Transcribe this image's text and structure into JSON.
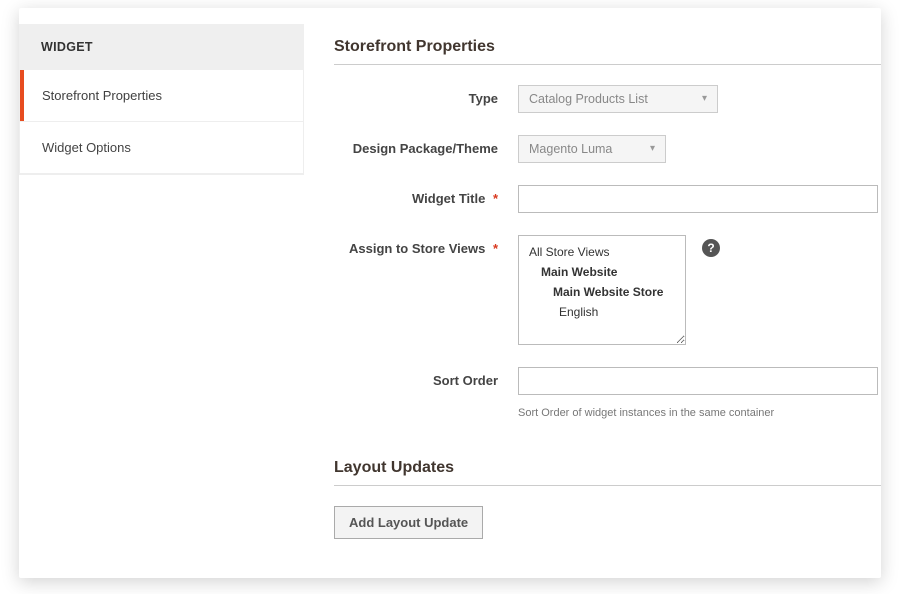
{
  "sidebar": {
    "header": "WIDGET",
    "tabs": [
      {
        "label": "Storefront Properties",
        "active": true
      },
      {
        "label": "Widget Options",
        "active": false
      }
    ]
  },
  "storefront": {
    "section_title": "Storefront Properties",
    "fields": {
      "type": {
        "label": "Type",
        "value": "Catalog Products List"
      },
      "theme": {
        "label": "Design Package/Theme",
        "value": "Magento Luma"
      },
      "title": {
        "label": "Widget Title",
        "value": ""
      },
      "store_views": {
        "label": "Assign to Store Views",
        "options": {
          "all": "All Store Views",
          "main_website": "Main Website",
          "main_store": "Main Website Store",
          "english": "English"
        }
      },
      "sort_order": {
        "label": "Sort Order",
        "value": "",
        "hint": "Sort Order of widget instances in the same container"
      }
    }
  },
  "layout_updates": {
    "section_title": "Layout Updates",
    "add_button": "Add Layout Update"
  },
  "glyphs": {
    "required": "*",
    "help": "?",
    "caret": "▾"
  }
}
